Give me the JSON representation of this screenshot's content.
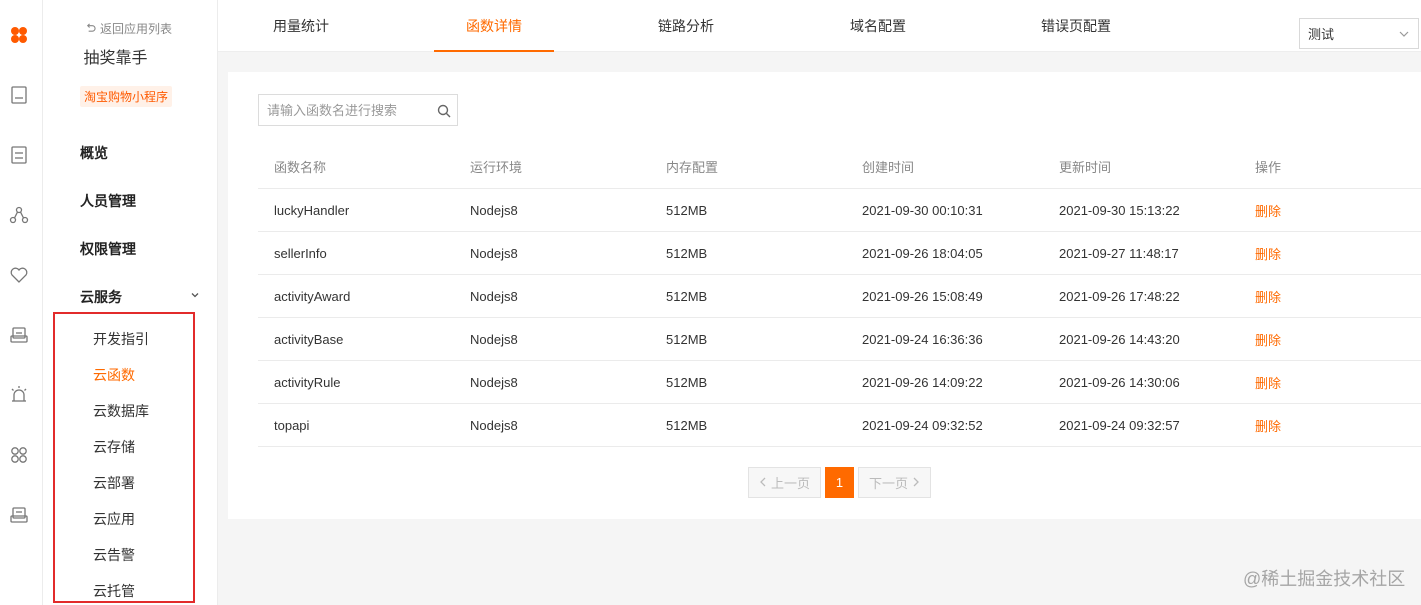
{
  "rail": {
    "icons": [
      "logo-flower-icon",
      "document-icon",
      "notes-icon",
      "share-icon",
      "heart-icon",
      "storage-icon",
      "alarm-icon",
      "grid-apps-icon",
      "server-icon"
    ],
    "accent": "#ff5a00"
  },
  "sidebar": {
    "back_label": "返回应用列表",
    "app_name": "抽奖靠手",
    "app_tag": "淘宝购物小程序",
    "nav": [
      {
        "label": "概览"
      },
      {
        "label": "人员管理"
      },
      {
        "label": "权限管理"
      },
      {
        "label": "云服务"
      }
    ],
    "sub_items": [
      {
        "label": "开发指引"
      },
      {
        "label": "云函数"
      },
      {
        "label": "云数据库"
      },
      {
        "label": "云存储"
      },
      {
        "label": "云部署"
      },
      {
        "label": "云应用"
      },
      {
        "label": "云告警"
      },
      {
        "label": "云托管"
      }
    ],
    "active_sub": "云函数",
    "highlight_color": "#e22b2b"
  },
  "tabs": [
    {
      "label": "用量统计"
    },
    {
      "label": "函数详情"
    },
    {
      "label": "链路分析"
    },
    {
      "label": "域名配置"
    },
    {
      "label": "错误页配置"
    }
  ],
  "active_tab": "函数详情",
  "env_select": {
    "value": "测试"
  },
  "search": {
    "placeholder": "请输入函数名进行搜索"
  },
  "table": {
    "headers": [
      "函数名称",
      "运行环境",
      "内存配置",
      "创建时间",
      "更新时间",
      "操作"
    ],
    "rows": [
      {
        "name": "luckyHandler",
        "runtime": "Nodejs8",
        "memory": "512MB",
        "created": "2021-09-30 00:10:31",
        "updated": "2021-09-30 15:13:22",
        "action": "删除"
      },
      {
        "name": "sellerInfo",
        "runtime": "Nodejs8",
        "memory": "512MB",
        "created": "2021-09-26 18:04:05",
        "updated": "2021-09-27 11:48:17",
        "action": "删除"
      },
      {
        "name": "activityAward",
        "runtime": "Nodejs8",
        "memory": "512MB",
        "created": "2021-09-26 15:08:49",
        "updated": "2021-09-26 17:48:22",
        "action": "删除"
      },
      {
        "name": "activityBase",
        "runtime": "Nodejs8",
        "memory": "512MB",
        "created": "2021-09-24 16:36:36",
        "updated": "2021-09-26 14:43:20",
        "action": "删除"
      },
      {
        "name": "activityRule",
        "runtime": "Nodejs8",
        "memory": "512MB",
        "created": "2021-09-26 14:09:22",
        "updated": "2021-09-26 14:30:06",
        "action": "删除"
      },
      {
        "name": "topapi",
        "runtime": "Nodejs8",
        "memory": "512MB",
        "created": "2021-09-24 09:32:52",
        "updated": "2021-09-24 09:32:57",
        "action": "删除"
      }
    ]
  },
  "pagination": {
    "prev": "上一页",
    "current": "1",
    "next": "下一页"
  },
  "watermark": "@稀土掘金技术社区",
  "colors": {
    "accent": "#ff6a00",
    "text": "#333333",
    "muted": "#888888"
  }
}
